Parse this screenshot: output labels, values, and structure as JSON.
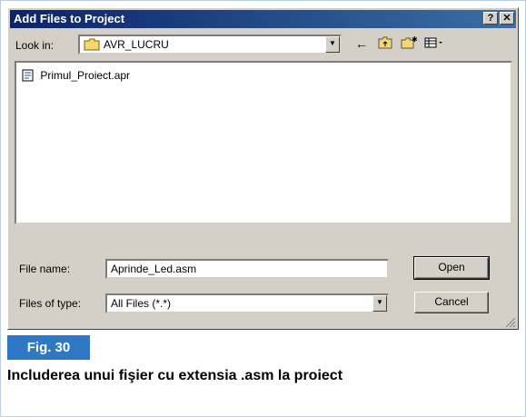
{
  "dialog": {
    "title": "Add Files to Project",
    "help_button": "?",
    "close_button": "✕",
    "look_in_label": "Look in:",
    "look_in_value": "AVR_LUCRU",
    "toolbar": {
      "back_icon": "←",
      "up_icon": "⬏",
      "new_folder_icon": "✱",
      "view_menu_icon": "▦▾"
    },
    "files": [
      {
        "name": "Primul_Proiect.apr",
        "icon": "project-file-icon"
      }
    ],
    "file_name_label": "File name:",
    "file_name_value": "Aprinde_Led.asm",
    "files_of_type_label": "Files of type:",
    "files_of_type_value": "All Files (*.*)",
    "open_button": "Open",
    "cancel_button": "Cancel"
  },
  "figure": {
    "label": "Fig. 30",
    "caption": "Includerea unui fişier cu extensia .asm la proiect"
  },
  "colors": {
    "title_gradient_start": "#0a246a",
    "title_gradient_end": "#3a6ea5",
    "dialog_face": "#d4d0c8",
    "figure_badge": "#2f78c4"
  }
}
